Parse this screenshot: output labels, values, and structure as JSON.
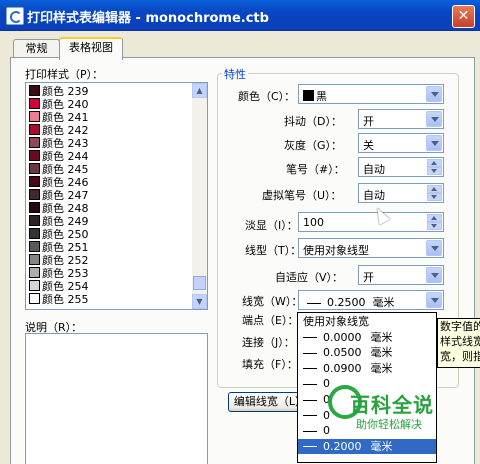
{
  "window": {
    "title": "打印样式表编辑器 - monochrome.ctb",
    "close": "✕"
  },
  "tabs": [
    {
      "label": "常规"
    },
    {
      "label": "表格视图"
    }
  ],
  "styles_group": {
    "label": "打印样式（P）："
  },
  "styles": [
    {
      "label": "颜色 239",
      "color": "#3a0c14"
    },
    {
      "label": "颜色 240",
      "color": "#d4003a"
    },
    {
      "label": "颜色 241",
      "color": "#ef7c93"
    },
    {
      "label": "颜色 242",
      "color": "#a8102f"
    },
    {
      "label": "颜色 243",
      "color": "#8a4a5b"
    },
    {
      "label": "颜色 244",
      "color": "#6a0a20"
    },
    {
      "label": "颜色 245",
      "color": "#6b3845"
    },
    {
      "label": "颜色 246",
      "color": "#480818"
    },
    {
      "label": "颜色 247",
      "color": "#3f2a30"
    },
    {
      "label": "颜色 248",
      "color": "#2a0812"
    },
    {
      "label": "颜色 249",
      "color": "#2e2226"
    },
    {
      "label": "颜色 250",
      "color": "#333333"
    },
    {
      "label": "颜色 251",
      "color": "#5a5a5a"
    },
    {
      "label": "颜色 252",
      "color": "#848484"
    },
    {
      "label": "颜色 253",
      "color": "#adadad"
    },
    {
      "label": "颜色 254",
      "color": "#d6d6d6"
    },
    {
      "label": "颜色 255",
      "color": "#ffffff"
    }
  ],
  "description": {
    "label": "说明（R）："
  },
  "properties": {
    "title": "特性",
    "color": {
      "label": "颜色（C）：",
      "value": "黑",
      "swatch": "#000000"
    },
    "dither": {
      "label": "抖动（D）：",
      "value": "开"
    },
    "grayscale": {
      "label": "灰度（G）：",
      "value": "关"
    },
    "pen": {
      "label": "笔号（#）：",
      "value": "自动"
    },
    "virtual_pen": {
      "label": "虚拟笔号（U）：",
      "value": "自动"
    },
    "screening": {
      "label": "淡显（I）：",
      "value": "100"
    },
    "linetype": {
      "label": "线型（T）：",
      "value": "使用对象线型"
    },
    "adaptive": {
      "label": "自适应（V）：",
      "value": "开"
    },
    "lineweight": {
      "label": "线宽（W）：",
      "value": "0.2500",
      "unit": "毫米"
    },
    "endstyle": {
      "label": "端点（E）："
    },
    "joinstyle": {
      "label": "连接（J）："
    },
    "fillstyle": {
      "label": "填充（F）："
    }
  },
  "lineweight_dropdown": [
    {
      "value": "使用对象线宽",
      "unit": ""
    },
    {
      "value": "0.0000",
      "unit": "毫米"
    },
    {
      "value": "0.0500",
      "unit": "毫米"
    },
    {
      "value": "0.0900",
      "unit": "毫米"
    },
    {
      "value": "0",
      "unit": ""
    },
    {
      "value": "0",
      "unit": ""
    },
    {
      "value": "0",
      "unit": ""
    },
    {
      "value": "0",
      "unit": ""
    },
    {
      "value": "0.2000",
      "unit": "毫米"
    }
  ],
  "tooltip": {
    "lines": [
      "数字值的",
      "样式线宽",
      "宽，则指"
    ]
  },
  "edit_lineweights_button": {
    "label": "编辑线宽（L）"
  },
  "watermark": {
    "title": "百科全说",
    "subtitle": "助你轻松解决"
  }
}
